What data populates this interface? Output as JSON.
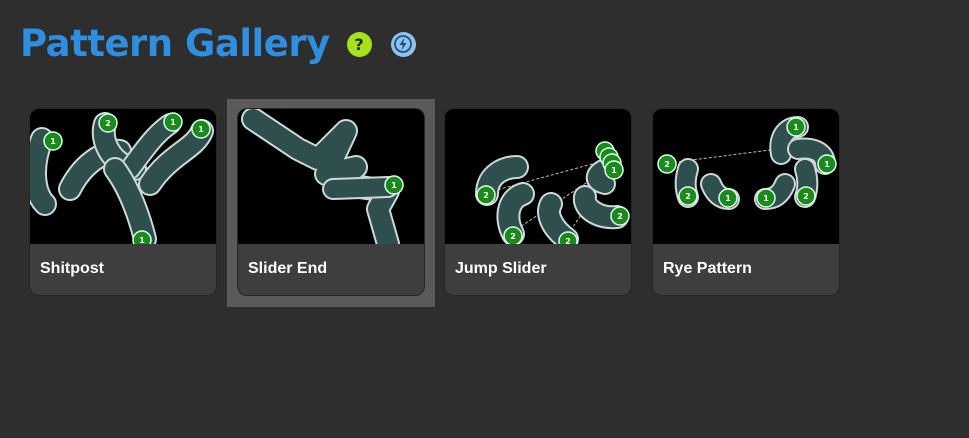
{
  "header": {
    "title": "Pattern Gallery",
    "help_icon": "question-circle-icon",
    "bolt_icon": "lightning-bolt-icon",
    "help_color": "#a6e21a",
    "bolt_color": "#8ec2ee",
    "title_color": "#2e8fe0"
  },
  "gallery": {
    "selected_index": 1,
    "cards": [
      {
        "label": "Shitpost"
      },
      {
        "label": "Slider End"
      },
      {
        "label": "Jump Slider"
      },
      {
        "label": "Rye Pattern"
      }
    ]
  },
  "colors": {
    "background": "#2e2e2e",
    "card": "#3e3e3e",
    "selected_frame": "#5a5a5a",
    "slider_body": "#2f4f4f",
    "hit_circle": "#1a8a1a"
  }
}
